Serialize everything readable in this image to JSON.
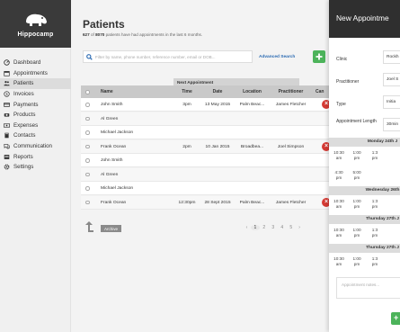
{
  "app": {
    "name": "Hippocamp"
  },
  "sidebar": {
    "items": [
      {
        "label": "Dashboard",
        "icon": "dashboard-icon"
      },
      {
        "label": "Appointments",
        "icon": "calendar-icon"
      },
      {
        "label": "Patients",
        "icon": "users-icon",
        "active": true
      },
      {
        "label": "Invoices",
        "icon": "invoice-icon"
      },
      {
        "label": "Payments",
        "icon": "card-icon"
      },
      {
        "label": "Products",
        "icon": "product-icon"
      },
      {
        "label": "Expenses",
        "icon": "money-icon"
      },
      {
        "label": "Contacts",
        "icon": "book-icon"
      },
      {
        "label": "Communication",
        "icon": "chat-icon"
      },
      {
        "label": "Reports",
        "icon": "report-icon"
      },
      {
        "label": "Settings",
        "icon": "gear-icon"
      }
    ]
  },
  "page": {
    "title": "Patients",
    "subtitle_count": "627",
    "subtitle_of": "of",
    "subtitle_total": "8070",
    "subtitle_rest": "patients have had appointments in the last 6 months."
  },
  "search": {
    "placeholder": "Filter by name, phone number, reference number, email or DOB...",
    "advanced_label": "Advanced Search"
  },
  "table": {
    "group_header": "Next Appointment",
    "headers": {
      "name": "Name",
      "time": "Time",
      "date": "Date",
      "location": "Location",
      "practitioner": "Practitioner",
      "cancel": "Can"
    },
    "rows": [
      {
        "name": "John Smith",
        "time": "3pm",
        "date": "13 May 2015",
        "location": "Palm Beac...",
        "practitioner": "James Fletcher",
        "has_delete": true
      },
      {
        "name": "Al Green",
        "time": "",
        "date": "",
        "location": "",
        "practitioner": "",
        "has_delete": false
      },
      {
        "name": "Michael Jackson",
        "time": "",
        "date": "",
        "location": "",
        "practitioner": "",
        "has_delete": false
      },
      {
        "name": "Frank Ocean",
        "time": "2pm",
        "date": "10 Jan 2015",
        "location": "Broadbea...",
        "practitioner": "Joel Simpson",
        "has_delete": true
      },
      {
        "name": "John Smith",
        "time": "",
        "date": "",
        "location": "",
        "practitioner": "",
        "has_delete": false
      },
      {
        "name": "Al Green",
        "time": "",
        "date": "",
        "location": "",
        "practitioner": "",
        "has_delete": false
      },
      {
        "name": "Michael Jackson",
        "time": "",
        "date": "",
        "location": "",
        "practitioner": "",
        "has_delete": false
      },
      {
        "name": "Frank Ocean",
        "time": "12:30pm",
        "date": "28 Sept 2015",
        "location": "Palm Beac...",
        "practitioner": "James Fletcher",
        "has_delete": true
      }
    ]
  },
  "footer": {
    "archive_label": "Archive",
    "pages": [
      "‹",
      "1",
      "2",
      "3",
      "4",
      "5",
      "›"
    ]
  },
  "modal": {
    "title": "New Appointme",
    "clinic_label": "Clinic",
    "clinic_value": "Rockh",
    "practitioner_label": "Practitioner",
    "practitioner_value": "Joel S",
    "type_label": "Type",
    "type_value": "Initia",
    "length_label": "Appointment Length",
    "length_value": "30min",
    "days": [
      {
        "label": "Monday 24th J",
        "slots": [
          [
            "10:30",
            "am"
          ],
          [
            "1:00",
            "pm"
          ],
          [
            "1:3",
            "pm"
          ],
          [
            "4:30",
            "pm"
          ],
          [
            "5:00",
            "pm"
          ]
        ]
      },
      {
        "label": "Wednesday 26th",
        "slots": [
          [
            "10:30",
            "am"
          ],
          [
            "1:00",
            "pm"
          ],
          [
            "1:3",
            "pm"
          ]
        ]
      },
      {
        "label": "Thursday 27th J",
        "slots": [
          [
            "10:30",
            "am"
          ],
          [
            "1:00",
            "pm"
          ],
          [
            "1:3",
            "pm"
          ]
        ]
      },
      {
        "label": "Thursday 27th J",
        "slots": [
          [
            "10:30",
            "am"
          ],
          [
            "1:00",
            "pm"
          ],
          [
            "1:3",
            "pm"
          ]
        ]
      }
    ],
    "notes_placeholder": "Appointment notes..."
  },
  "colors": {
    "accent_green": "#4cb35a",
    "delete_red": "#d63a34",
    "header_dark": "#2f2f2f",
    "link_blue": "#2a6ab2"
  }
}
